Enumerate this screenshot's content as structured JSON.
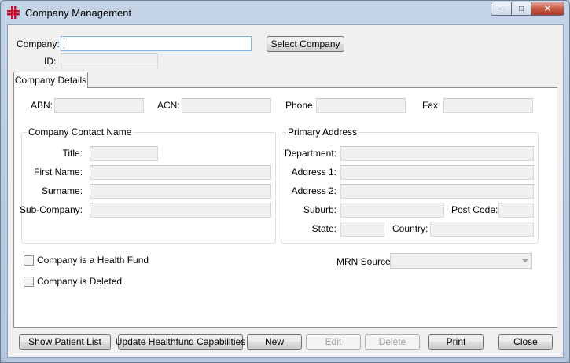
{
  "window": {
    "title": "Company Management",
    "controls": {
      "minimize": "–",
      "maximize": "□",
      "close": "✕"
    }
  },
  "header": {
    "company_label": "Company:",
    "company_value": "",
    "id_label": "ID:",
    "id_value": "",
    "select_company_button": "Select Company"
  },
  "tabs": [
    {
      "label": "Company Details",
      "selected": true
    }
  ],
  "details": {
    "abn_label": "ABN:",
    "acn_label": "ACN:",
    "phone_label": "Phone:",
    "fax_label": "Fax:"
  },
  "contact": {
    "title": "Company Contact Name",
    "title_label": "Title:",
    "first_name_label": "First Name:",
    "surname_label": "Surname:",
    "sub_company_label": "Sub-Company:"
  },
  "address": {
    "title": "Primary Address",
    "department_label": "Department:",
    "address1_label": "Address 1:",
    "address2_label": "Address 2:",
    "suburb_label": "Suburb:",
    "postcode_label": "Post Code:",
    "state_label": "State:",
    "country_label": "Country:"
  },
  "options": {
    "health_fund_label": "Company is a Health Fund",
    "health_fund_checked": false,
    "deleted_label": "Company is Deleted",
    "deleted_checked": false,
    "mrn_source_label": "MRN Source:",
    "mrn_source_value": ""
  },
  "buttons": {
    "show_patient_list": "Show Patient List",
    "update_healthfund": "Update Healthfund Capabilities",
    "new": "New",
    "edit": "Edit",
    "delete": "Delete",
    "print": "Print",
    "close": "Close"
  },
  "colors": {
    "icon_red": "#c8102e",
    "focus_border": "#7eb4ea"
  }
}
